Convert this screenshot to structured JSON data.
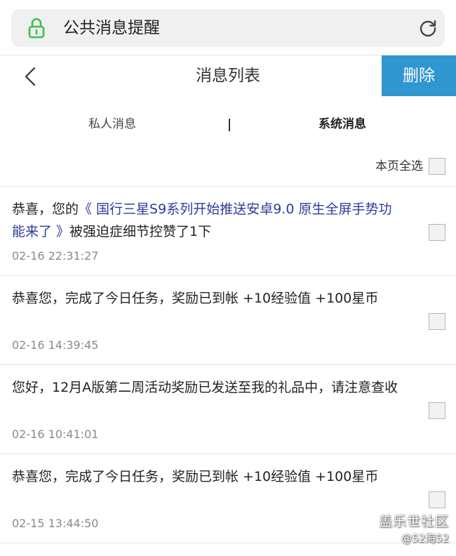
{
  "address_bar": {
    "title": "公共消息提醒",
    "lock_icon": "lock-icon",
    "reload_icon": "reload-icon",
    "lock_color": "#3cbf4f"
  },
  "header": {
    "title": "消息列表",
    "back_icon": "chevron-left-icon",
    "delete_label": "删除",
    "delete_color": "#2f96cf"
  },
  "tabs": {
    "private_label": "私人消息",
    "system_label": "系统消息",
    "active": "系统消息"
  },
  "select_all_label": "本页全选",
  "messages": [
    {
      "prefix": "恭喜，您的",
      "link": "《 国行三星S9系列开始推送安卓9.0 原生全屏手势功能来了 》",
      "suffix": "被强迫症细节控赞了1下",
      "time": "02-16 22:31:27"
    },
    {
      "prefix": "恭喜您，完成了今日任务，奖励已到帐 +10经验值 +100星币",
      "link": "",
      "suffix": "",
      "time": "02-16 14:39:45"
    },
    {
      "prefix": "您好，12月A版第二周活动奖励已发送至我的礼品中，请注意查收",
      "link": "",
      "suffix": "",
      "time": "02-16 10:41:01"
    },
    {
      "prefix": "恭喜您，完成了今日任务，奖励已到帐 +10经验值 +100星币",
      "link": "",
      "suffix": "",
      "time": "02-15 13:44:50"
    }
  ],
  "watermark": {
    "line1": "盖乐世社区",
    "line2": "@52海52"
  }
}
